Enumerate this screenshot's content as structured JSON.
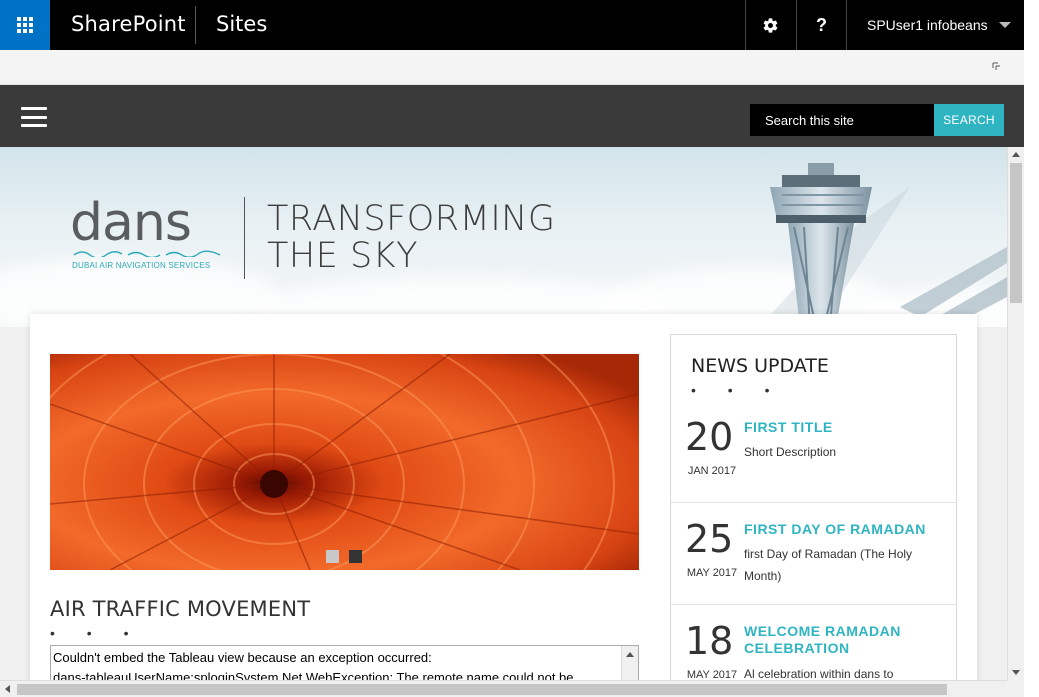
{
  "suite_bar": {
    "app_launcher_icon": "waffle-icon",
    "brand": "SharePoint",
    "sites_label": "Sites",
    "settings_icon": "gear-icon",
    "help_label": "?",
    "user_name": "SPUser1 infobeans",
    "accent_color": "#0072c6"
  },
  "ribbon": {
    "focus_icon": "focus-on-content-icon"
  },
  "top_nav": {
    "menu_icon": "hamburger-menu-icon",
    "search_placeholder": "Search this site",
    "search_button": "SEARCH",
    "search_color": "#2fb5c2"
  },
  "hero": {
    "logo_text": "dans",
    "logo_subtitle": "DUBAI AIR NAVIGATION SERVICES",
    "tagline_line1": "TRANSFORMING",
    "tagline_line2": "THE SKY"
  },
  "slider": {
    "image": "orange-chrysanthemum-flower",
    "slide_count": 2,
    "active_slide": 2
  },
  "air_traffic": {
    "title": "AIR TRAFFIC MOVEMENT",
    "title_dots": "• • •",
    "error_line1": "Couldn't embed the Tableau view because an exception occurred:",
    "error_line2": "dans-tableauUserName:sploginSystem.Net.WebException: The remote name could not be resolved:"
  },
  "news": {
    "title": "NEWS UPDATE",
    "title_dots": "• • •",
    "items": [
      {
        "day": "20",
        "month": "JAN 2017",
        "heading": "FIRST TITLE",
        "description": "Short Description"
      },
      {
        "day": "25",
        "month": "MAY 2017",
        "heading": "FIRST DAY OF RAMADAN",
        "description": "first Day of Ramadan (The Holy Month)"
      },
      {
        "day": "18",
        "month": "MAY 2017",
        "heading": "WELCOME RAMADAN CELEBRATION",
        "description": "Al celebration within dans to"
      }
    ]
  }
}
